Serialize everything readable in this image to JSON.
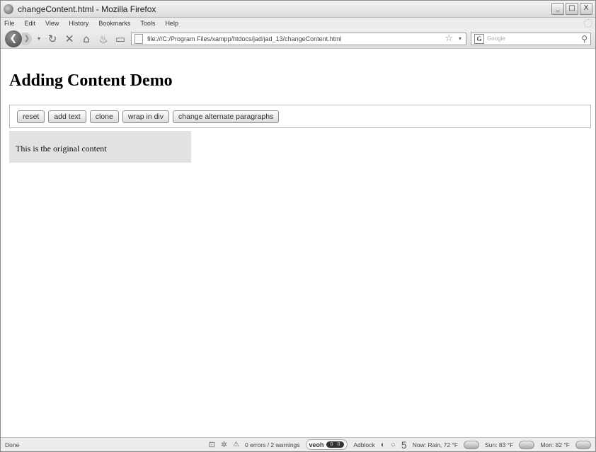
{
  "window": {
    "title": "changeContent.html - Mozilla Firefox",
    "controls": {
      "minimize": "_",
      "maximize": "□",
      "close": "X"
    }
  },
  "menu": [
    "File",
    "Edit",
    "View",
    "History",
    "Bookmarks",
    "Tools",
    "Help"
  ],
  "nav": {
    "url": "file:///C:/Program Files/xampp/htdocs/jad/jad_13/changeContent.html",
    "search_placeholder": "Google",
    "search_engine_glyph": "G"
  },
  "page": {
    "heading": "Adding Content Demo",
    "buttons": {
      "reset": "reset",
      "add_text": "add text",
      "clone": "clone",
      "wrap_in_div": "wrap in div",
      "change_alternate": "change alternate paragraphs"
    },
    "content_text": "This is the original content"
  },
  "status": {
    "done": "Done",
    "errors": "0 errors / 2 warnings",
    "veoh_label": "veoh",
    "veoh_counts": [
      "0",
      "0"
    ],
    "adblock": "Adblock",
    "counter": "5",
    "weather_now": "Now: Rain, 72 °F",
    "weather_sun": "Sun: 83 °F",
    "weather_mon": "Mon: 82 °F"
  }
}
